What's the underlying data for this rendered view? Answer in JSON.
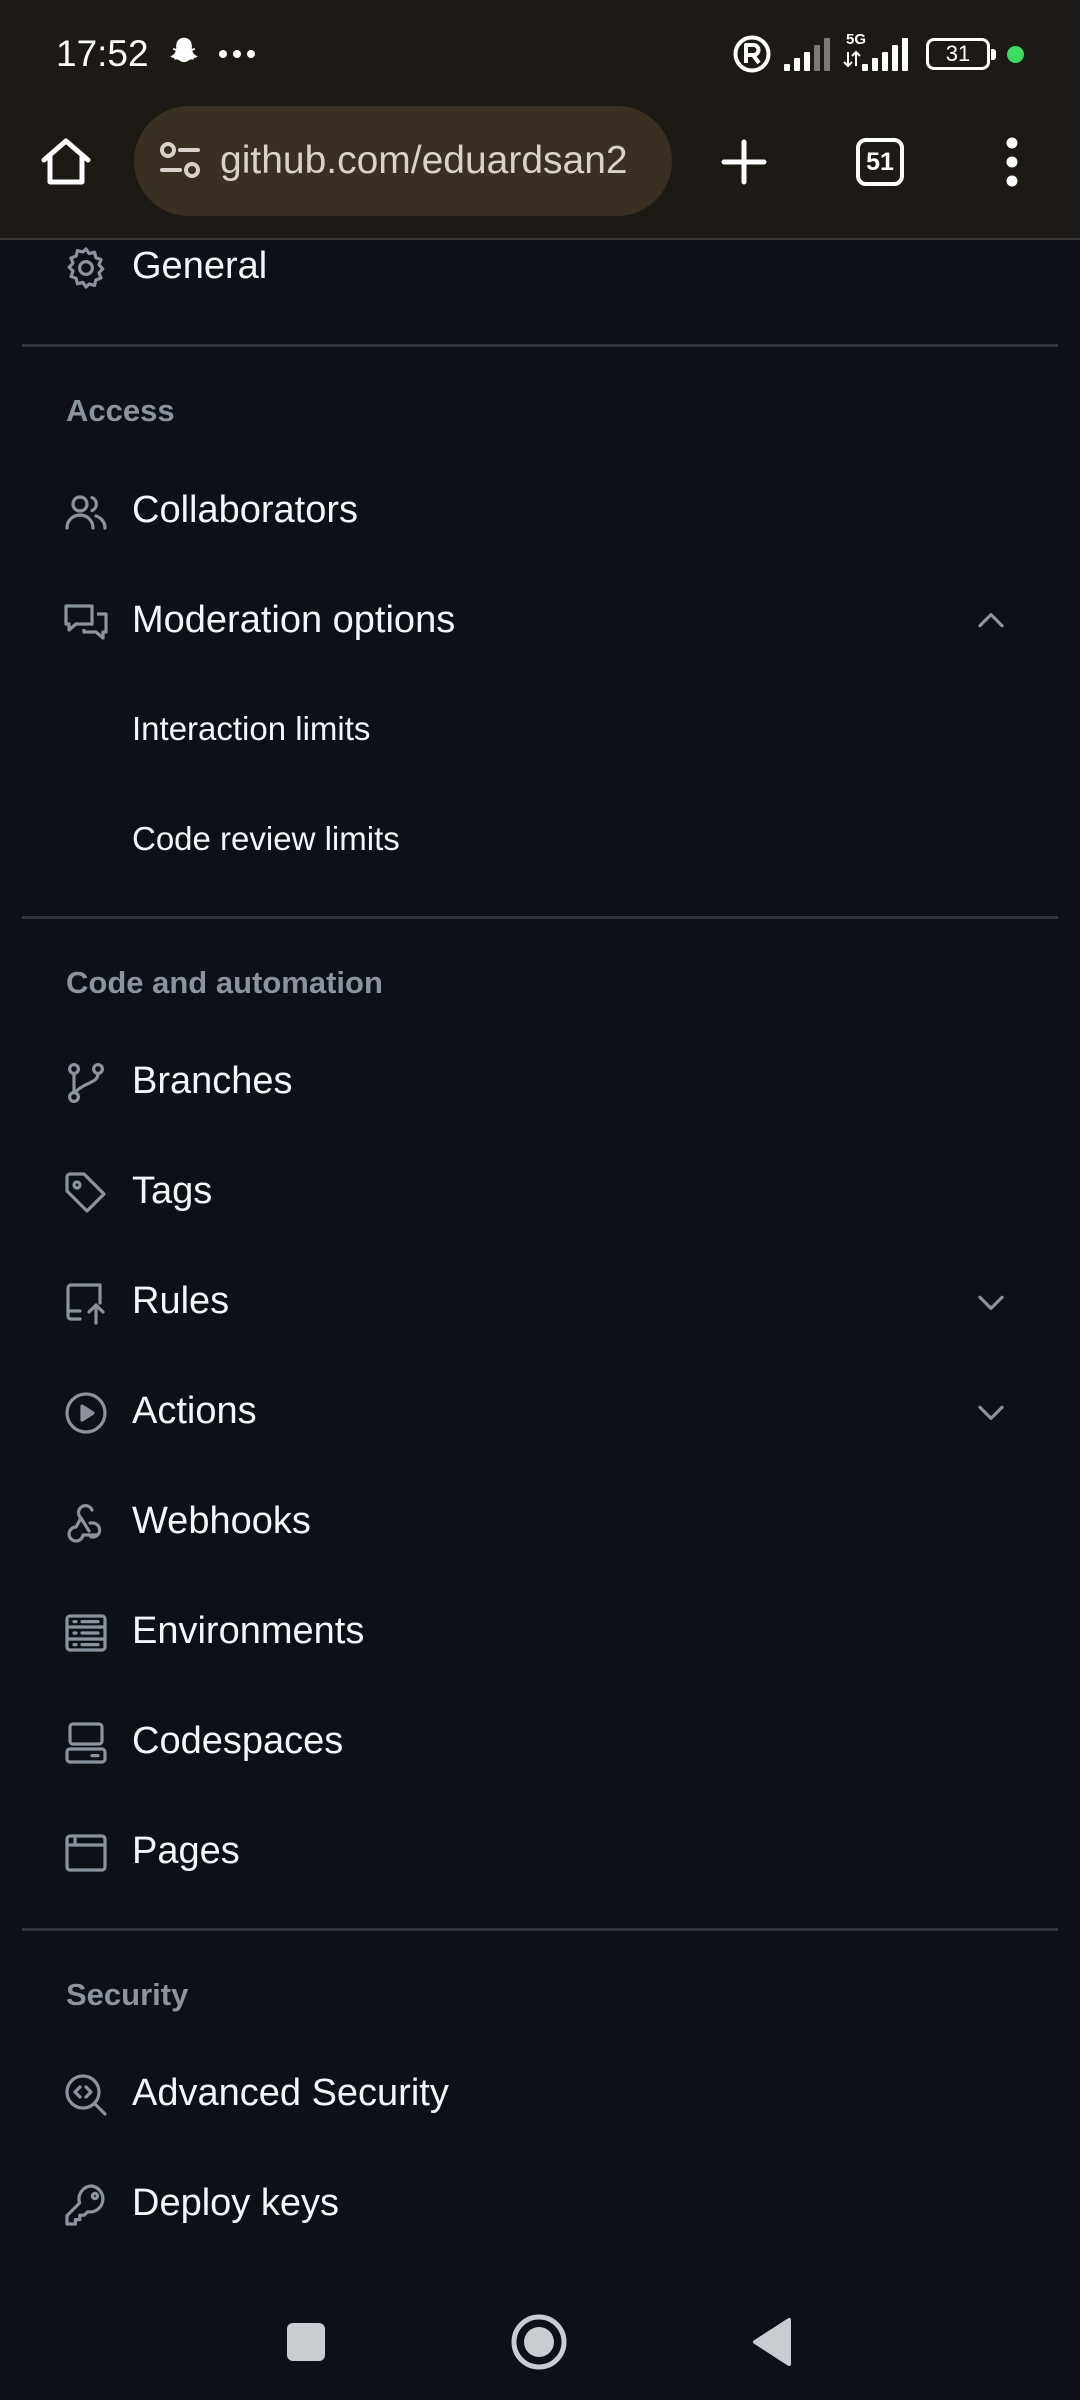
{
  "status_bar": {
    "time": "17:52",
    "battery": "31",
    "network": "5G",
    "left_icons": [
      "snapchat-icon",
      "more-dots-icon"
    ],
    "right_icons": [
      "registered-icon",
      "signal-icon",
      "signal-5g-icon",
      "battery-icon",
      "privacy-dot"
    ]
  },
  "browser": {
    "url": "github.com/eduardsan2",
    "tab_count": "51",
    "icons": [
      "home-icon",
      "site-settings-icon",
      "new-tab-icon",
      "tab-switcher",
      "menu-kebab-icon"
    ]
  },
  "menu": {
    "general": {
      "label": "General",
      "icon": "gear-icon"
    },
    "access": {
      "title": "Access",
      "collaborators": {
        "label": "Collaborators",
        "icon": "people-icon"
      },
      "moderation": {
        "label": "Moderation options",
        "icon": "comment-discussion-icon",
        "expanded": true,
        "sub_items": [
          "Interaction limits",
          "Code review limits"
        ]
      }
    },
    "code_and_automation": {
      "title": "Code and automation",
      "branches": {
        "label": "Branches",
        "icon": "git-branch-icon"
      },
      "tags": {
        "label": "Tags",
        "icon": "tag-icon"
      },
      "rules": {
        "label": "Rules",
        "icon": "repo-push-icon",
        "expanded": false
      },
      "actions": {
        "label": "Actions",
        "icon": "play-icon",
        "expanded": false
      },
      "webhooks": {
        "label": "Webhooks",
        "icon": "webhook-icon"
      },
      "environments": {
        "label": "Environments",
        "icon": "server-icon"
      },
      "codespaces": {
        "label": "Codespaces",
        "icon": "codespaces-icon"
      },
      "pages": {
        "label": "Pages",
        "icon": "browser-icon"
      }
    },
    "security": {
      "title": "Security",
      "advanced_security": {
        "label": "Advanced Security",
        "icon": "codescan-icon"
      },
      "deploy_keys": {
        "label": "Deploy keys",
        "icon": "key-icon"
      }
    }
  },
  "nav_bar": {
    "icons": [
      "recents-square-icon",
      "home-circle-icon",
      "back-triangle-icon"
    ]
  },
  "colors": {
    "page_background": "#0d1117",
    "chrome_background": "#1d1914",
    "url_pill": "#393021",
    "text_primary": "#f0f6fc",
    "text_muted": "#8b949e",
    "divider": "#30363d",
    "privacy_dot": "#3ddc5f"
  }
}
